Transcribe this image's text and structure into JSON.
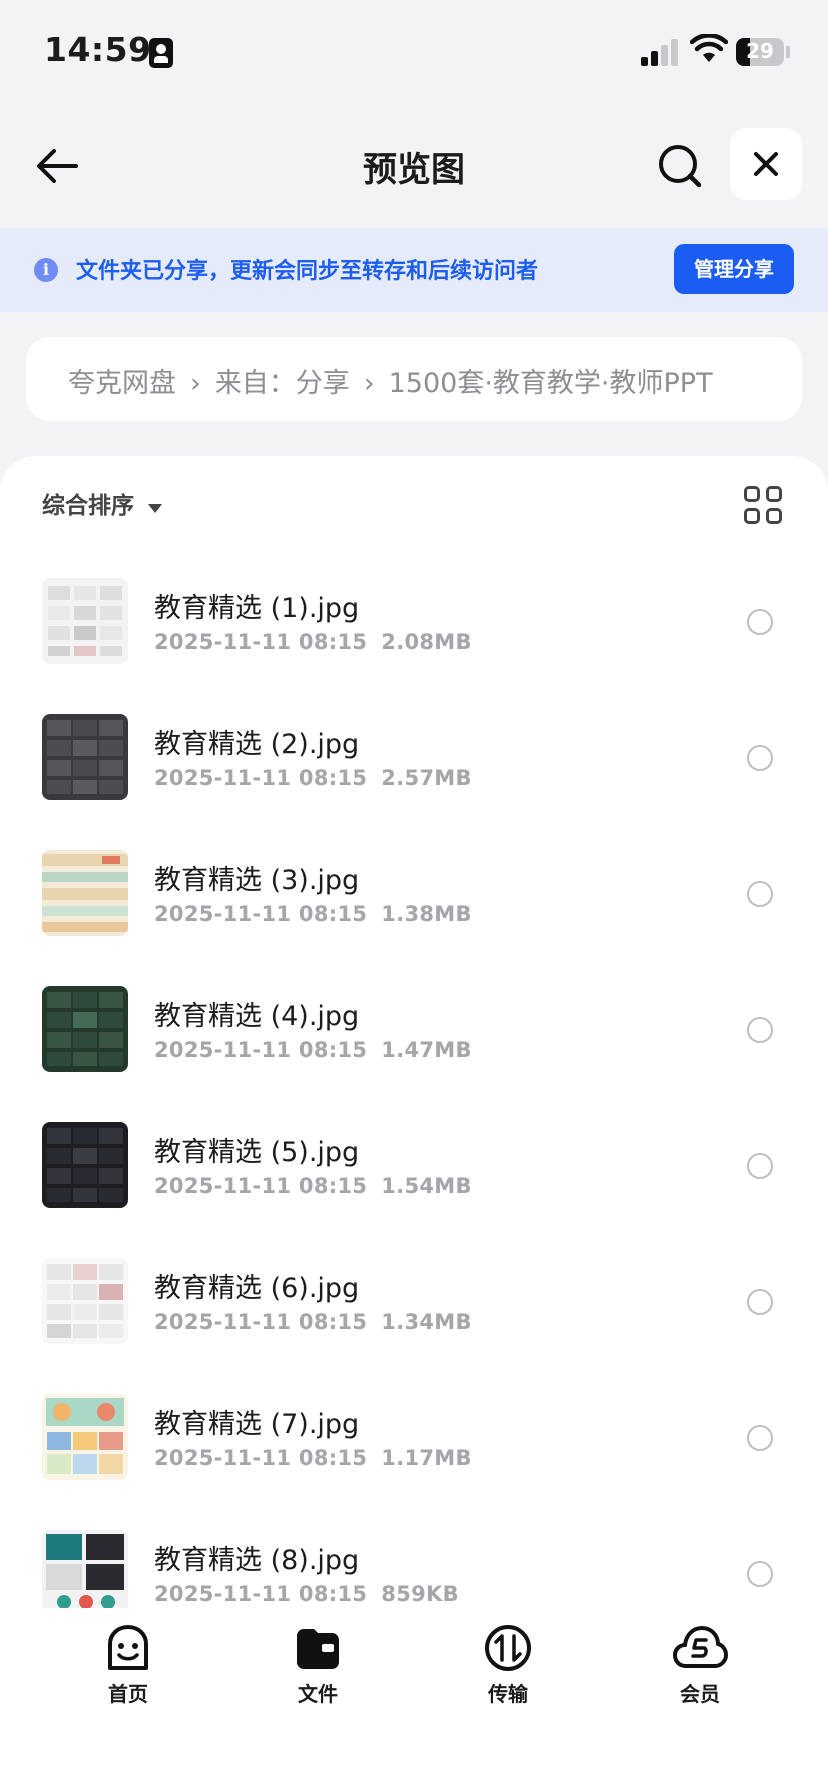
{
  "status_bar": {
    "time": "14:59",
    "battery": "29",
    "battery_level": 0.29
  },
  "header": {
    "title": "预览图"
  },
  "banner": {
    "text": "文件夹已分享，更新会同步至转存和后续访问者",
    "button": "管理分享",
    "accent": "#1b5cf2"
  },
  "breadcrumb": {
    "items": [
      "夸克网盘",
      "来自：分享",
      "1500套·教育教学·教师PPT"
    ]
  },
  "sort": {
    "label": "综合排序"
  },
  "files": [
    {
      "name": "教育精选 (1).jpg",
      "date": "2025-11-11 08:15",
      "size": "2.08MB",
      "thumb": "light-grid"
    },
    {
      "name": "教育精选 (2).jpg",
      "date": "2025-11-11 08:15",
      "size": "2.57MB",
      "thumb": "dark-gray"
    },
    {
      "name": "教育精选 (3).jpg",
      "date": "2025-11-11 08:15",
      "size": "1.38MB",
      "thumb": "beige-stripes"
    },
    {
      "name": "教育精选 (4).jpg",
      "date": "2025-11-11 08:15",
      "size": "1.47MB",
      "thumb": "dark-green"
    },
    {
      "name": "教育精选 (5).jpg",
      "date": "2025-11-11 08:15",
      "size": "1.54MB",
      "thumb": "black-grid"
    },
    {
      "name": "教育精选 (6).jpg",
      "date": "2025-11-11 08:15",
      "size": "1.34MB",
      "thumb": "white-red"
    },
    {
      "name": "教育精选 (7).jpg",
      "date": "2025-11-11 08:15",
      "size": "1.17MB",
      "thumb": "colorful"
    },
    {
      "name": "教育精选 (8).jpg",
      "date": "2025-11-11 08:15",
      "size": "859KB",
      "thumb": "teal-black"
    }
  ],
  "tabs": [
    {
      "label": "首页",
      "icon": "smile-face-icon"
    },
    {
      "label": "文件",
      "icon": "folder-icon"
    },
    {
      "label": "传输",
      "icon": "transfer-icon"
    },
    {
      "label": "会员",
      "icon": "cloud-member-icon"
    }
  ]
}
